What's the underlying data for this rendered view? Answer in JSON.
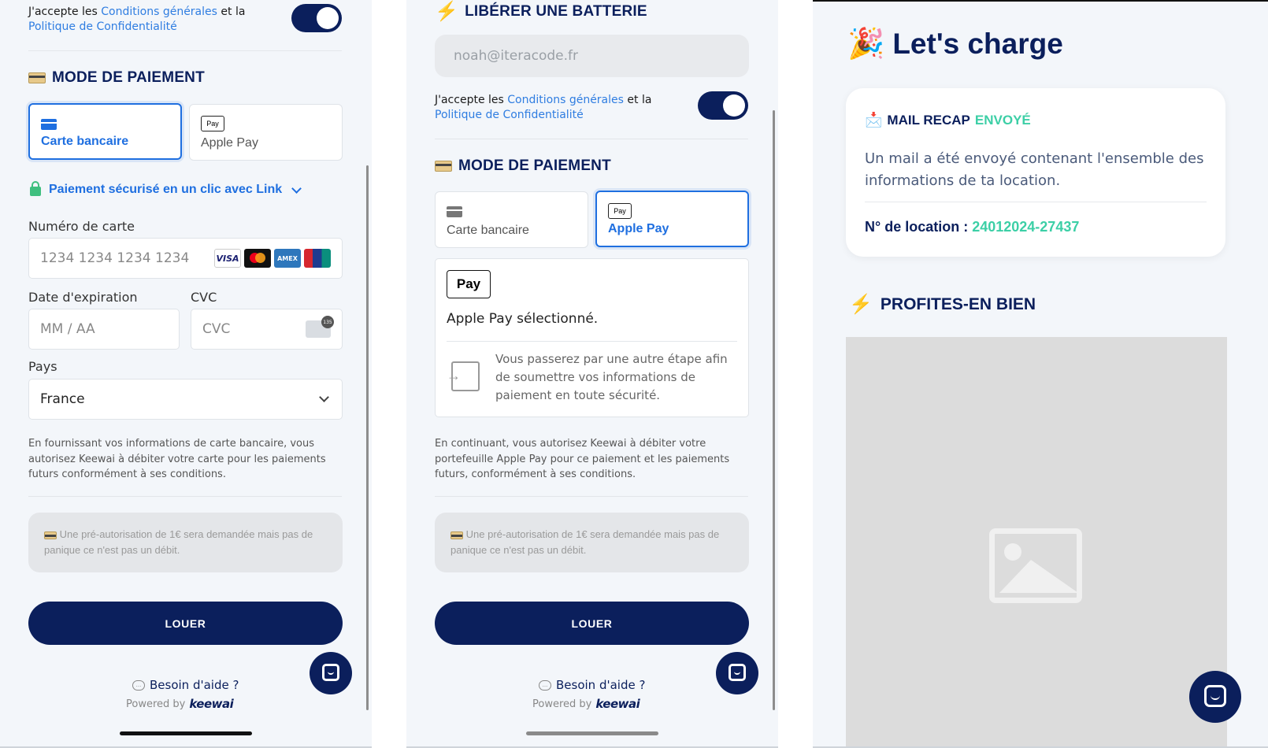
{
  "common": {
    "terms_prefix": "J'accepte les ",
    "terms_link1": "Conditions générales",
    "terms_mid": " et la",
    "terms_link2": "Politique de Confidentialité",
    "payment_title": "MODE DE PAIEMENT",
    "tab_card": "Carte bancaire",
    "tab_applepay": "Apple Pay",
    "notice": "Une pré-autorisation de 1€ sera demandée mais pas de panique ce n'est pas un débit.",
    "cta": "LOUER",
    "help": "Besoin d'aide ?",
    "powered": "Powered by",
    "brand": "keewai",
    "colors": {
      "navy": "#0b1f5c",
      "blue": "#1f6fe0",
      "mint": "#3ccfa6",
      "bg": "#f3f6fa"
    }
  },
  "panel1": {
    "link_pay": "Paiement sécurisé en un clic avec Link",
    "card_number_label": "Numéro de carte",
    "card_number_placeholder": "1234 1234 1234 1234",
    "brands": [
      "VISA",
      "Mastercard",
      "AMEX",
      "UnionPay"
    ],
    "exp_label": "Date d'expiration",
    "exp_placeholder": "MM / AA",
    "cvc_label": "CVC",
    "cvc_placeholder": "CVC",
    "country_label": "Pays",
    "country_value": "France",
    "disclaimer": "En fournissant vos informations de carte bancaire, vous autorisez Keewai à débiter votre carte pour les paiements futurs conformément à ses conditions."
  },
  "panel2": {
    "section_title": "LIBÉRER UNE BATTERIE",
    "email_value": "noah@iteracode.fr",
    "applepay_logo": "Pay",
    "applepay_selected": "Apple Pay sélectionné.",
    "applepay_info": "Vous passerez par une autre étape afin de soumettre vos informations de paiement en toute sécurité.",
    "disclaimer": "En continuant, vous autorisez Keewai à débiter votre portefeuille Apple Pay pour ce paiement et les paiements futurs, conformément à ses conditions."
  },
  "panel3": {
    "title": "Let's charge",
    "mail_title": "MAIL RECAP",
    "mail_status": "ENVOYÉ",
    "mail_text": "Un mail a été envoyé contenant l'ensemble des informations de ta location.",
    "location_label": "N° de location :",
    "location_number": "24012024-27437",
    "profite": "PROFITES-EN BIEN"
  }
}
